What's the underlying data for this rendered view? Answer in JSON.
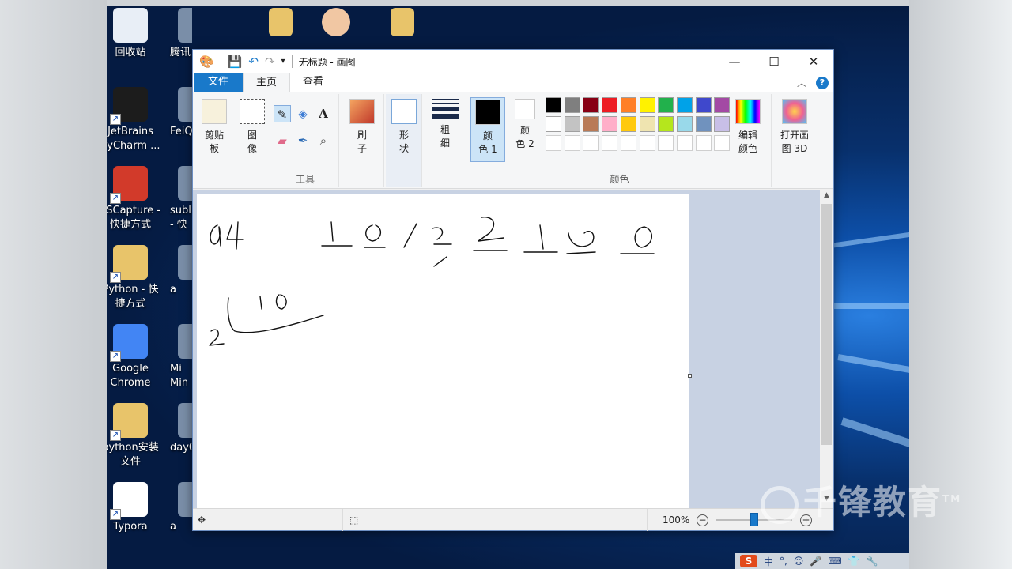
{
  "desktop": {
    "icons": [
      {
        "label": "回收站",
        "icon": "recycle-bin-icon",
        "color": "#e8eef6"
      },
      {
        "label": "JetBrains PyCharm ...",
        "icon": "pycharm-icon",
        "color": "#1c1c1c"
      },
      {
        "label": "FSCapture - 快捷方式",
        "icon": "fscapture-icon",
        "color": "#d23a2a"
      },
      {
        "label": "Python - 快捷方式",
        "icon": "folder-icon",
        "color": "#e8c46a"
      },
      {
        "label": "Google Chrome",
        "icon": "chrome-icon",
        "color": "#4285f4"
      },
      {
        "label": "python安装文件",
        "icon": "folder-icon",
        "color": "#e8c46a"
      },
      {
        "label": "Typora",
        "icon": "typora-icon",
        "color": "#ffffff"
      }
    ],
    "partial_icons": [
      {
        "label": "腾讯",
        "icon": "qq-icon"
      },
      {
        "label": "FeiQ",
        "icon": "feiq-icon"
      },
      {
        "label": "subli - 快",
        "icon": "sublime-icon"
      },
      {
        "label": "a",
        "icon": "app-icon"
      },
      {
        "label": "Mi Min",
        "icon": "app-icon"
      },
      {
        "label": "day0",
        "icon": "app-icon"
      },
      {
        "label": "a",
        "icon": "app-icon"
      }
    ],
    "top_icons": [
      "folder-icon",
      "user-avatar-icon",
      "folder-icon"
    ]
  },
  "paint": {
    "title": "无标题 - 画图",
    "tabs": {
      "file": "文件",
      "home": "主页",
      "view": "查看"
    },
    "clipboard": {
      "label": "剪贴\n板"
    },
    "image": {
      "label": "图\n像"
    },
    "tools_group": "工具",
    "brushes": {
      "label": "刷\n子"
    },
    "shapes": {
      "label": "形\n状"
    },
    "size": {
      "label": "粗\n细"
    },
    "color1": {
      "label": "颜\n色 1",
      "value": "#000000"
    },
    "color2": {
      "label": "颜\n色 2",
      "value": "#ffffff"
    },
    "colors_group": "颜色",
    "edit_colors": "编辑\n颜色",
    "paint3d": "打开画\n图 3D",
    "palette_row1": [
      "#000000",
      "#7f7f7f",
      "#880015",
      "#ed1c24",
      "#ff7f27",
      "#fff200",
      "#22b14c",
      "#00a2e8",
      "#3f48cc",
      "#a349a4"
    ],
    "palette_row2": [
      "#ffffff",
      "#c3c3c3",
      "#b97a57",
      "#ffaec9",
      "#ffc90e",
      "#efe4b0",
      "#b5e61d",
      "#99d9ea",
      "#7092be",
      "#c8bfe7"
    ],
    "status": {
      "zoom": "100%",
      "zoom_level": 0.5
    }
  },
  "tray": {
    "ime": "中",
    "badge": "S"
  },
  "watermark": {
    "text": "千锋教育",
    "tm": "TM"
  }
}
